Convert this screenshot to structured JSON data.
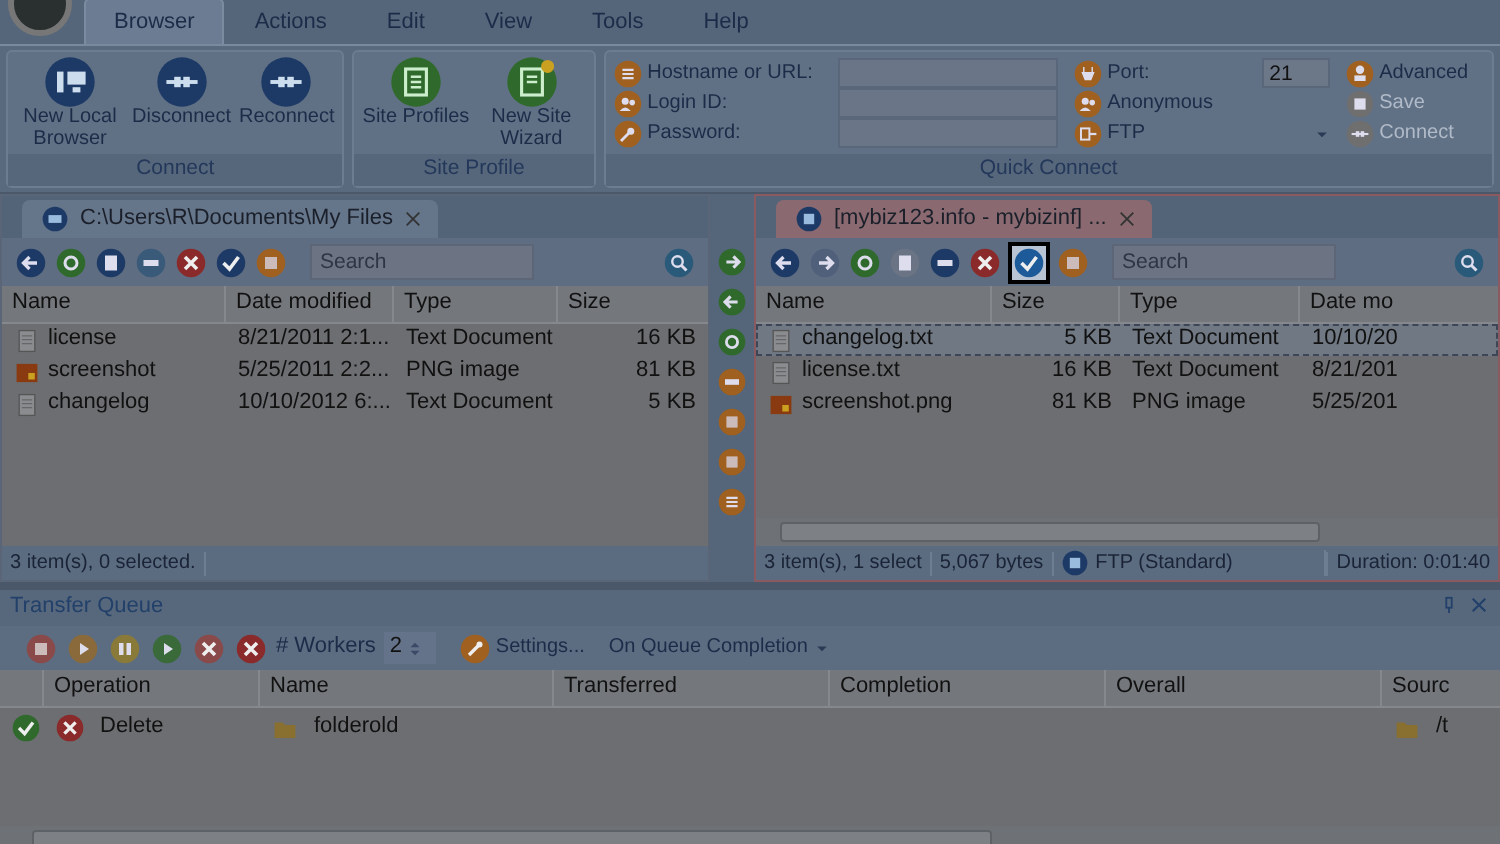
{
  "ribbon_tabs": [
    {
      "label": "Browser",
      "selected": true
    },
    {
      "label": "Actions",
      "selected": false
    },
    {
      "label": "Edit",
      "selected": false
    },
    {
      "label": "View",
      "selected": false
    },
    {
      "label": "Tools",
      "selected": false
    },
    {
      "label": "Help",
      "selected": false
    }
  ],
  "ribbon_groups": [
    {
      "title": "Connect",
      "buttons": [
        {
          "label": "New Local Browser",
          "kind": "computer"
        },
        {
          "label": "Disconnect",
          "kind": "plug"
        },
        {
          "label": "Reconnect",
          "kind": "plug"
        }
      ]
    },
    {
      "title": "Site Profile",
      "buttons": [
        {
          "label": "Site Profiles",
          "kind": "profile"
        },
        {
          "label": "New Site Wizard",
          "kind": "wizard"
        }
      ]
    }
  ],
  "quick_connect": {
    "title": "Quick Connect",
    "fields": [
      {
        "label": "Hostname or URL:"
      },
      {
        "label": "Login ID:"
      },
      {
        "label": "Password:"
      }
    ],
    "port_label": "Port:",
    "port": "21",
    "anonymous": "Anonymous",
    "protocol": "FTP",
    "actions": [
      {
        "label": "Advanced",
        "disabled": false
      },
      {
        "label": "Save",
        "disabled": true
      },
      {
        "label": "Connect",
        "disabled": true
      }
    ]
  },
  "local_panel": {
    "tab_title": "C:\\Users\\R\\Documents\\My Files",
    "search_placeholder": "Search",
    "columns": [
      "Name",
      "Date modified",
      "Type",
      "Size"
    ],
    "rows": [
      {
        "kind": "text",
        "selected": false,
        "cells": [
          "license",
          "8/21/2011 2:1...",
          "Text Document",
          "16 KB"
        ]
      },
      {
        "kind": "image",
        "selected": false,
        "cells": [
          "screenshot",
          "5/25/2011 2:2...",
          "PNG image",
          "81 KB"
        ]
      },
      {
        "kind": "text",
        "selected": false,
        "cells": [
          "changelog",
          "10/10/2012 6:...",
          "Text Document",
          "5 KB"
        ]
      }
    ],
    "status": [
      "3 item(s), 0 selected."
    ]
  },
  "remote_panel": {
    "tab_title": "[mybiz123.info - mybizinf] ...",
    "search_placeholder": "Search",
    "toolbar": [
      {
        "highlighted": false
      },
      {
        "highlighted": false
      },
      {
        "highlighted": false
      },
      {
        "highlighted": false
      },
      {
        "highlighted": false
      },
      {
        "highlighted": false
      },
      {
        "highlighted": true
      },
      {
        "highlighted": false
      }
    ],
    "columns": [
      "Name",
      "Size",
      "Type",
      "Date mo"
    ],
    "rows": [
      {
        "kind": "text",
        "selected": true,
        "cells": [
          "changelog.txt",
          "5 KB",
          "Text Document",
          "10/10/20"
        ]
      },
      {
        "kind": "text",
        "selected": false,
        "cells": [
          "license.txt",
          "16 KB",
          "Text Document",
          "8/21/201"
        ]
      },
      {
        "kind": "image",
        "selected": false,
        "cells": [
          "screenshot.png",
          "81 KB",
          "PNG image",
          "5/25/201"
        ]
      }
    ],
    "status": [
      "3 item(s), 1 select",
      "5,067 bytes",
      "FTP (Standard)",
      "Duration: 0:01:40"
    ]
  },
  "transfer_queue": {
    "title": "Transfer Queue",
    "workers_label": "# Workers",
    "workers": "2",
    "settings": "Settings...",
    "completion": "On Queue Completion",
    "columns": [
      "Operation",
      "Name",
      "Transferred",
      "Completion",
      "Overall",
      "Sourc"
    ],
    "rows": [
      {
        "kind": "done",
        "operation": "Delete",
        "name": "folderold",
        "source": "/t"
      }
    ]
  }
}
